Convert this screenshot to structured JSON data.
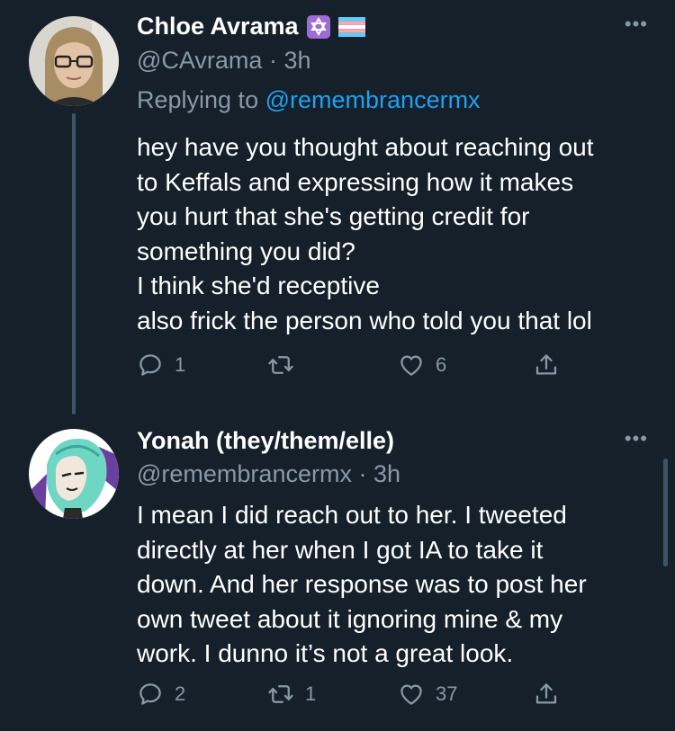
{
  "colors": {
    "background": "#15202b",
    "text": "#ffffff",
    "secondary": "#8899a6",
    "link": "#1da1f2",
    "thread_line": "#3d5466"
  },
  "tweets": [
    {
      "name": "Chloe Avrama",
      "badges": [
        "star-of-david-icon",
        "trans-flag-icon"
      ],
      "handle": "@CAvrama",
      "separator": "·",
      "time": "3h",
      "replying_label": "Replying to",
      "replying_to": "@remembrancermx",
      "lines": [
        "hey have you thought about reaching out",
        "to Keffals and expressing how it makes",
        "you hurt that she's getting credit for",
        "something you did?",
        "I think she'd receptive",
        "also frick the person who told you that lol"
      ],
      "replies": "1",
      "retweets": "",
      "likes": "6"
    },
    {
      "name": "Yonah (they/them/elle)",
      "handle": "@remembrancermx",
      "separator": "·",
      "time": "3h",
      "lines": [
        "I mean I did reach out to her. I tweeted",
        "directly at her when I got IA to take it",
        "down. And her response was to post her",
        "own tweet about it ignoring mine & my",
        "work. I dunno it’s not a great look."
      ],
      "replies": "2",
      "retweets": "1",
      "likes": "37"
    }
  ],
  "more_icon": "•••"
}
